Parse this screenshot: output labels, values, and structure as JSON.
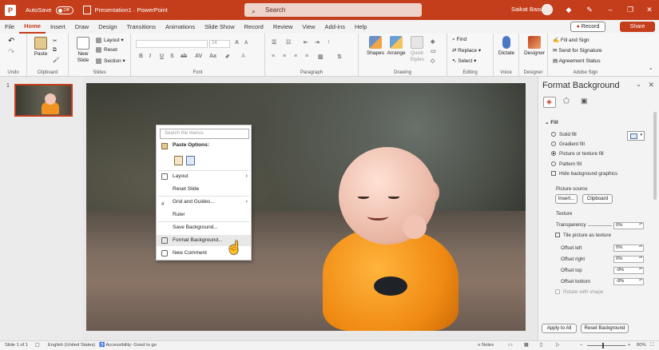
{
  "titlebar": {
    "autosave_label": "AutoSave",
    "autosave_state": "Off",
    "doc_title": "Presentation1 · PowerPoint",
    "search_placeholder": "Search",
    "user_name": "Saikat Basu",
    "accent_color": "#c43e1c"
  },
  "menu": {
    "tabs": [
      "File",
      "Home",
      "Insert",
      "Draw",
      "Design",
      "Transitions",
      "Animations",
      "Slide Show",
      "Record",
      "Review",
      "View",
      "Add-ins",
      "Help"
    ],
    "active_tab": "Home",
    "record_label": "Record",
    "share_label": "Share"
  },
  "ribbon": {
    "groups": {
      "undo": "Undo",
      "clipboard": "Clipboard",
      "slides": "Slides",
      "font": "Font",
      "paragraph": "Paragraph",
      "drawing": "Drawing",
      "editing": "Editing",
      "voice": "Voice",
      "designer": "Designer",
      "adobe": "Adobe Sign"
    },
    "paste": "Paste",
    "new_slide": "New Slide",
    "layout": "Layout",
    "reset": "Reset",
    "section": "Section",
    "font_size": "24",
    "shapes": "Shapes",
    "arrange": "Arrange",
    "quick_styles": "Quick Styles",
    "find": "Find",
    "replace": "Replace",
    "select": "Select",
    "dictate": "Dictate",
    "designer_btn": "Designer",
    "fill_sign": "Fill and Sign",
    "send_signature": "Send for Signature",
    "agreement_status": "Agreement Status"
  },
  "thumbs": {
    "slide_number": "1"
  },
  "context_menu": {
    "search_placeholder": "Search the menus",
    "paste_options": "Paste Options:",
    "items": [
      "Layout",
      "Reset Slide",
      "Grid and Guides...",
      "Ruler",
      "Save Background...",
      "Format Background...",
      "New Comment"
    ]
  },
  "format_pane": {
    "title": "Format Background",
    "section": "Fill",
    "fill_options": [
      "Solid fill",
      "Gradient fill",
      "Picture or texture fill",
      "Pattern fill"
    ],
    "selected_fill": "Picture or texture fill",
    "hide_graphics": "Hide background graphics",
    "picture_source": "Picture source",
    "insert_btn": "Insert...",
    "clipboard_btn": "Clipboard",
    "texture": "Texture",
    "transparency": "Transparency",
    "transparency_value": "0%",
    "tile": "Tile picture as texture",
    "offset_left": "Offset left",
    "offset_left_value": "0%",
    "offset_right": "Offset right",
    "offset_right_value": "0%",
    "offset_top": "Offset top",
    "offset_top_value": "-9%",
    "offset_bottom": "Offset bottom",
    "offset_bottom_value": "-9%",
    "rotate": "Rotate with shape",
    "apply_all": "Apply to All",
    "reset_bg": "Reset Background"
  },
  "status": {
    "slide_of": "Slide 1 of 1",
    "language": "English (United States)",
    "accessibility": "Accessibility: Good to go",
    "notes": "Notes",
    "zoom": "80%"
  }
}
